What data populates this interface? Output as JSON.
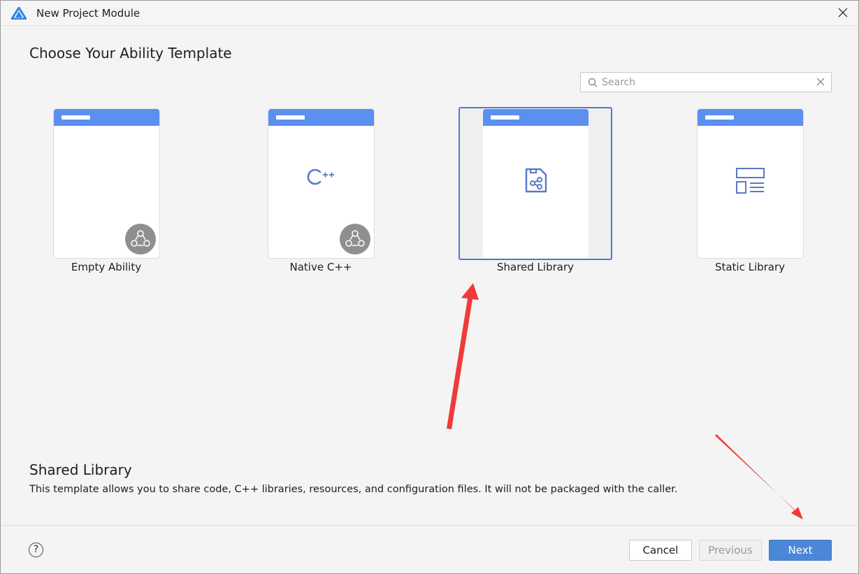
{
  "window": {
    "title": "New Project Module"
  },
  "heading": "Choose Your Ability Template",
  "search": {
    "placeholder": "Search",
    "value": ""
  },
  "templates": [
    {
      "label": "Empty Ability",
      "icon": "none",
      "badge": "atomic-service-icon",
      "selected": false
    },
    {
      "label": "Native C++",
      "icon": "cpp-icon",
      "badge": "atomic-service-icon",
      "selected": false
    },
    {
      "label": "Shared Library",
      "icon": "shared-library-icon",
      "badge": "",
      "selected": true
    },
    {
      "label": "Static Library",
      "icon": "static-library-icon",
      "badge": "",
      "selected": false
    }
  ],
  "description": {
    "title": "Shared Library",
    "text": "This template allows you to share code, C++ libraries, resources, and configuration files. It will not be packaged with the caller."
  },
  "footer": {
    "help_label": "?",
    "cancel_label": "Cancel",
    "previous_label": "Previous",
    "next_label": "Next"
  },
  "colors": {
    "accent": "#4a87d6",
    "card_header": "#5b8ff0",
    "selection_border": "#4a7fc1",
    "annotation_arrow": "#f03a3a"
  }
}
